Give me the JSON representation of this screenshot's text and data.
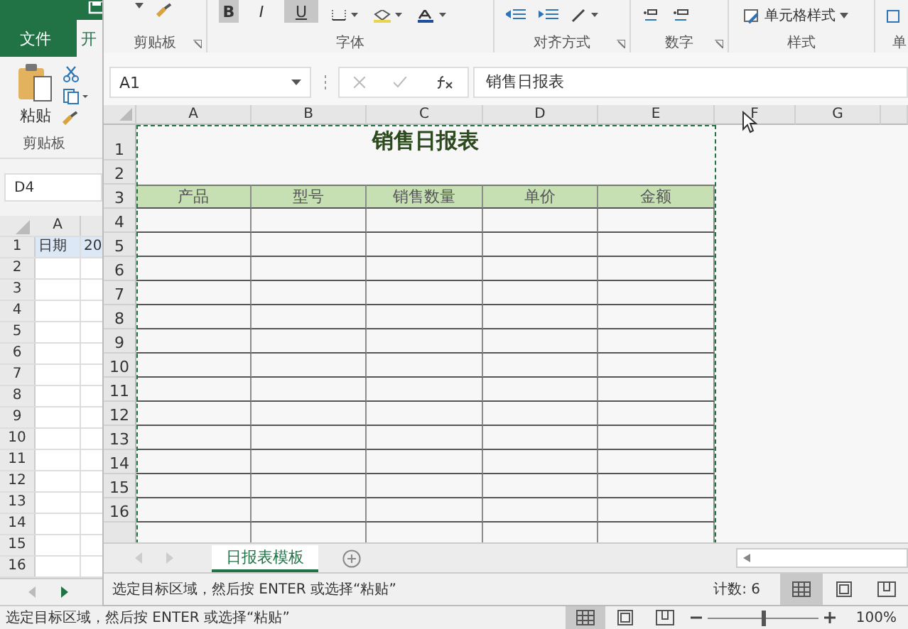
{
  "background_window": {
    "tabs": [
      {
        "label": "文件",
        "selected": false
      },
      {
        "label": "开",
        "selected": true
      }
    ],
    "paste_label": "粘贴",
    "clipboard_group": "剪贴板",
    "name_box": "D4",
    "column_header": "A",
    "rows": [
      {
        "number": "1",
        "cells": [
          "日期",
          "20"
        ]
      },
      {
        "number": "2"
      },
      {
        "number": "3"
      },
      {
        "number": "4"
      },
      {
        "number": "5"
      },
      {
        "number": "6"
      },
      {
        "number": "7"
      },
      {
        "number": "8"
      },
      {
        "number": "9"
      },
      {
        "number": "10"
      },
      {
        "number": "11"
      },
      {
        "number": "12"
      },
      {
        "number": "13"
      },
      {
        "number": "14"
      },
      {
        "number": "15"
      },
      {
        "number": "16"
      }
    ],
    "status_text": "选定目标区域，然后按 ENTER 或选择“粘贴”",
    "view_buttons": [
      {
        "kind": "normal",
        "selected": true
      },
      {
        "kind": "page_layout",
        "selected": false
      },
      {
        "kind": "page_break",
        "selected": false
      }
    ],
    "zoom": {
      "level": 0.5,
      "reading": "100%"
    }
  },
  "front_window": {
    "font_buttons": [
      {
        "label": "B",
        "selected": true
      },
      {
        "label": "I",
        "selected": false
      },
      {
        "label": "U",
        "selected": true
      }
    ],
    "groups": [
      {
        "label": "剪贴板",
        "launcher": true
      },
      {
        "label": "字体",
        "launcher": false
      },
      {
        "label": "对齐方式",
        "launcher": true
      },
      {
        "label": "数字",
        "launcher": true
      },
      {
        "label": "样式",
        "launcher": false
      },
      {
        "label": "单",
        "launcher": false
      }
    ],
    "cell_styles_button": "单元格样式",
    "name_box": "A1",
    "formula": "销售日报表",
    "columns": [
      "A",
      "B",
      "C",
      "D",
      "E",
      "F",
      "G"
    ],
    "title": "销售日报表",
    "headers": [
      "产品",
      "型号",
      "销售数量",
      "单价",
      "金额"
    ],
    "row_numbers": [
      "1",
      "2",
      "3",
      "4",
      "5",
      "6",
      "7",
      "8",
      "9",
      "10",
      "11",
      "12",
      "13",
      "14",
      "15",
      "16"
    ],
    "sheet_tab": {
      "label": "日报表模板",
      "selected": true
    },
    "status_text": "选定目标区域，然后按 ENTER 或选择“粘贴”",
    "count": "计数: 6",
    "view_buttons": [
      {
        "kind": "normal",
        "selected": true
      },
      {
        "kind": "page_layout",
        "selected": false
      },
      {
        "kind": "page_break",
        "selected": false
      }
    ]
  }
}
